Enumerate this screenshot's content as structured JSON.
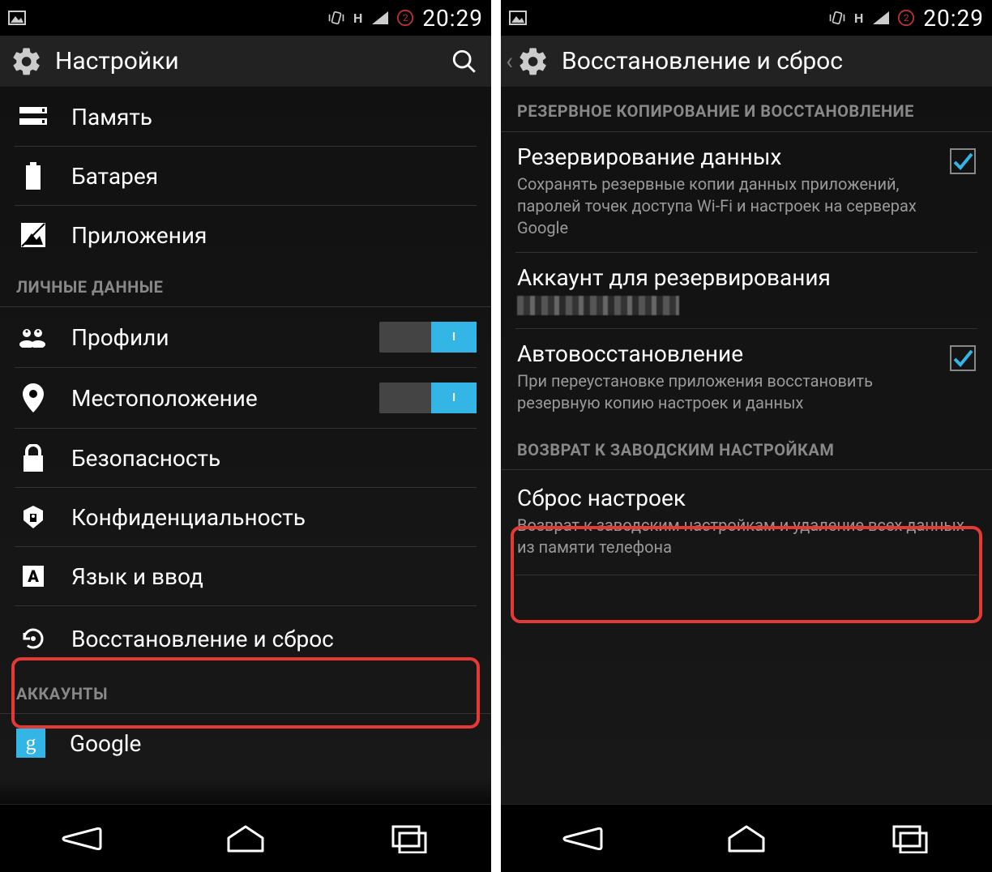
{
  "status": {
    "time": "20:29",
    "network_type": "H",
    "signal_count": "2"
  },
  "left": {
    "title": "Настройки",
    "rows": {
      "memory": "Память",
      "battery": "Батарея",
      "apps": "Приложения"
    },
    "section_personal": "ЛИЧНЫЕ ДАННЫЕ",
    "profiles": "Профили",
    "location": "Местоположение",
    "security": "Безопасность",
    "privacy": "Конфиденциальность",
    "language": "Язык и ввод",
    "backup_reset": "Восстановление и сброс",
    "section_accounts": "АККАУНТЫ",
    "google": "Google",
    "toggle_on": "I"
  },
  "right": {
    "title": "Восстановление и сброс",
    "section_backup": "РЕЗЕРВНОЕ КОПИРОВАНИЕ И ВОССТАНОВЛЕНИЕ",
    "backup_data_title": "Резервирование данных",
    "backup_data_sub": "Сохранять резервные копии данных приложений, паролей точек доступа Wi-Fi и настроек на серверах Google",
    "backup_account_title": "Аккаунт для резервирования",
    "auto_restore_title": "Автовосстановление",
    "auto_restore_sub": "При переустановке приложения восстановить резервную копию настроек и данных",
    "section_factory": "ВОЗВРАТ К ЗАВОДСКИМ НАСТРОЙКАМ",
    "factory_reset_title": "Сброс настроек",
    "factory_reset_sub": "Возврат к заводским настройкам и удаление всех данных из памяти телефона"
  }
}
